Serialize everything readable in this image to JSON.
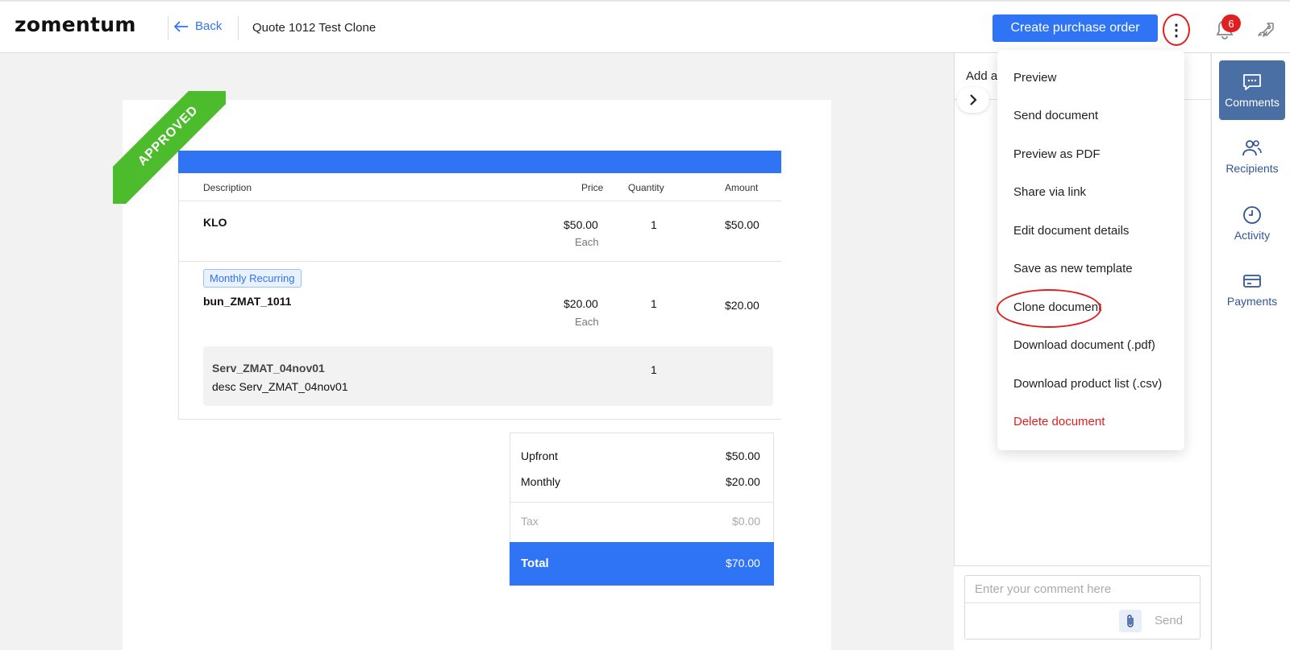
{
  "header": {
    "logo": "zomentum",
    "back_label": "Back",
    "quote_title": "Quote 1012 Test Clone",
    "create_po_label": "Create purchase order",
    "more_glyph": "⋮",
    "notification_count": "6"
  },
  "document": {
    "ribbon": "APPROVED",
    "columns": [
      "Description",
      "Price",
      "Quantity",
      "Amount"
    ],
    "items": [
      {
        "name": "KLO",
        "price": "$50.00",
        "unit": "Each",
        "quantity": "1",
        "amount": "$50.00"
      },
      {
        "tag": "Monthly Recurring",
        "name": "bun_ZMAT_1011",
        "price": "$20.00",
        "unit": "Each",
        "quantity": "1",
        "amount": "$20.00"
      }
    ],
    "sub_item": {
      "name": "Serv_ZMAT_04nov01",
      "desc": "desc Serv_ZMAT_04nov01",
      "quantity": "1"
    },
    "totals": {
      "upfront_label": "Upfront",
      "upfront_value": "$50.00",
      "monthly_label": "Monthly",
      "monthly_value": "$20.00",
      "tax_label": "Tax",
      "tax_value": "$0.00",
      "total_label": "Total",
      "total_value": "$70.00"
    }
  },
  "panel": {
    "title_partial": "Add a",
    "comment_placeholder": "Enter your comment here",
    "send_label": "Send"
  },
  "rail": {
    "comments": "Comments",
    "recipients": "Recipients",
    "activity": "Activity",
    "payments": "Payments"
  },
  "menu": {
    "items": [
      "Preview",
      "Send document",
      "Preview as PDF",
      "Share via link",
      "Edit document details",
      "Save as new template",
      "Clone document",
      "Download document (.pdf)",
      "Download product list (.csv)",
      "Delete document"
    ]
  },
  "colors": {
    "accent": "#2f74f5",
    "approved": "#4cbc2c",
    "danger": "#e02020",
    "rail_active": "#4a6fa5"
  }
}
